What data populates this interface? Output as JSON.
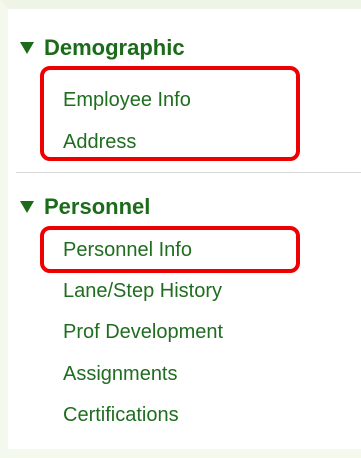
{
  "sections": [
    {
      "title": "Demographic",
      "items": [
        "Employee Info",
        "Address"
      ]
    },
    {
      "title": "Personnel",
      "items": [
        "Personnel Info",
        "Lane/Step History",
        "Prof Development",
        "Assignments",
        "Certifications"
      ]
    }
  ],
  "colors": {
    "link": "#1f6d1f",
    "header": "#1b6b1b",
    "highlight": "#ee0000",
    "background": "#f4f9ee"
  },
  "icons": {
    "expanded": "triangle-down-icon"
  }
}
